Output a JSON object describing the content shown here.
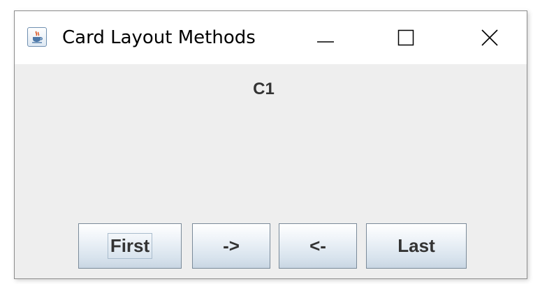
{
  "window": {
    "title": "Card Layout Methods",
    "icon": "java-cup-icon"
  },
  "title_controls": [
    "minimize-icon",
    "maximize-icon",
    "close-icon"
  ],
  "card": {
    "label": "C1"
  },
  "buttons": {
    "first": "First",
    "next": "->",
    "previous": "<-",
    "last": "Last"
  }
}
